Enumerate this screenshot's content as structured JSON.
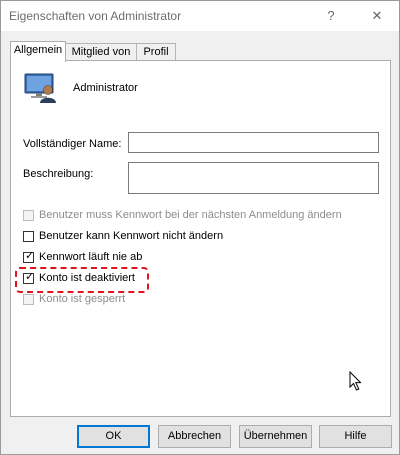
{
  "window": {
    "title": "Eigenschaften von Administrator",
    "help_symbol": "?",
    "close_symbol": "✕"
  },
  "tabs": [
    {
      "label": "Allgemein",
      "active": true
    },
    {
      "label": "Mitglied von",
      "active": false
    },
    {
      "label": "Profil",
      "active": false
    }
  ],
  "user": {
    "icon": "user-monitor-icon",
    "name": "Administrator"
  },
  "fields": {
    "full_name_label": "Vollständiger Name:",
    "full_name_value": "",
    "description_label": "Beschreibung:",
    "description_value": ""
  },
  "checkboxes": [
    {
      "label": "Benutzer muss Kennwort bei der nächsten Anmeldung ändern",
      "checked": false,
      "disabled": true
    },
    {
      "label": "Benutzer kann Kennwort nicht ändern",
      "checked": false,
      "disabled": false
    },
    {
      "label": "Kennwort läuft nie ab",
      "checked": true,
      "disabled": false
    },
    {
      "label": "Konto ist deaktiviert",
      "checked": true,
      "disabled": false,
      "highlighted": true
    },
    {
      "label": "Konto ist gesperrt",
      "checked": false,
      "disabled": true
    }
  ],
  "buttons": {
    "ok": "OK",
    "cancel": "Abbrechen",
    "apply": "Übernehmen",
    "help": "Hilfe"
  },
  "colors": {
    "highlight": "#e1141c",
    "default_button_border": "#0078d7"
  }
}
